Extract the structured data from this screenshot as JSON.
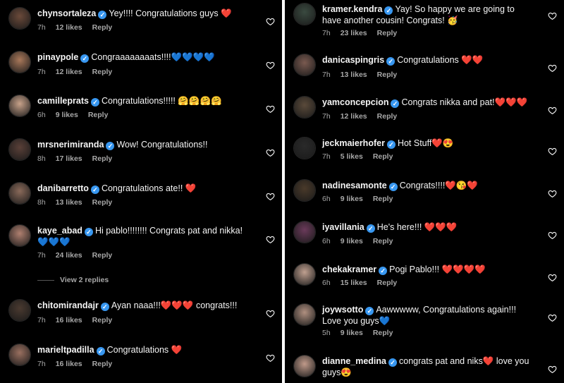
{
  "left_comments": [
    {
      "user": "chynsortaleza",
      "text": "Yey!!!! Congratulations guys ❤️",
      "time": "7h",
      "likes": "12 likes",
      "reply": "Reply"
    },
    {
      "user": "pinaypole",
      "text": "Congraaaaaaaats!!!!💙💙💙💙",
      "time": "7h",
      "likes": "12 likes",
      "reply": "Reply"
    },
    {
      "user": "camilleprats",
      "text": "Congratulations!!!!! 🤗🤗🤗🤗",
      "time": "6h",
      "likes": "9 likes",
      "reply": "Reply"
    },
    {
      "user": "mrsnerimiranda",
      "text": "Wow! Congratulations!!",
      "time": "8h",
      "likes": "17 likes",
      "reply": "Reply"
    },
    {
      "user": "danibarretto",
      "text": "Congratulations ate!! ❤️",
      "time": "8h",
      "likes": "13 likes",
      "reply": "Reply"
    },
    {
      "user": "kaye_abad",
      "text": "Hi pablo!!!!!!!! Congrats pat and nikka! 💙💙💙",
      "time": "7h",
      "likes": "24 likes",
      "reply": "Reply"
    },
    {
      "user": "chitomirandajr",
      "text": "Ayan naaa!!!❤️❤️❤️ congrats!!!",
      "time": "7h",
      "likes": "16 likes",
      "reply": "Reply"
    },
    {
      "user": "marieltpadilla",
      "text": "Congratulations ❤️",
      "time": "7h",
      "likes": "16 likes",
      "reply": "Reply"
    }
  ],
  "view_replies": "View 2 replies",
  "right_comments": [
    {
      "user": "kramer.kendra",
      "text": "Yay! So happy we are going to have another cousin! Congrats! 🥳",
      "time": "7h",
      "likes": "23 likes",
      "reply": "Reply"
    },
    {
      "user": "danicaspingris",
      "text": "Congratulations ❤️❤️",
      "time": "7h",
      "likes": "13 likes",
      "reply": "Reply"
    },
    {
      "user": "yamconcepcion",
      "text": "Congrats nikka and pat!❤️❤️❤️",
      "time": "7h",
      "likes": "12 likes",
      "reply": "Reply"
    },
    {
      "user": "jeckmaierhofer",
      "text": "Hot Stuff❤️😍",
      "time": "7h",
      "likes": "5 likes",
      "reply": "Reply"
    },
    {
      "user": "nadinesamonte",
      "text": "Congrats!!!!❤️😘❤️",
      "time": "6h",
      "likes": "9 likes",
      "reply": "Reply"
    },
    {
      "user": "iyavillania",
      "text": "He's here!!! ❤️❤️❤️",
      "time": "6h",
      "likes": "9 likes",
      "reply": "Reply"
    },
    {
      "user": "chekakramer",
      "text": "Pogi Pablo!!! ❤️❤️❤️❤️",
      "time": "6h",
      "likes": "15 likes",
      "reply": "Reply"
    },
    {
      "user": "joywsotto",
      "text": "Aawwwww, Congratulations again!!! Love you guys💙",
      "time": "5h",
      "likes": "9 likes",
      "reply": "Reply"
    },
    {
      "user": "dianne_medina",
      "text": "congrats pat and niks❤️ love you guys😍",
      "time": "",
      "likes": "",
      "reply": ""
    }
  ],
  "colors": {
    "background": "#000000",
    "text": "#f5f5f5",
    "meta": "#a8a8a8",
    "verified": "#3897f0"
  }
}
